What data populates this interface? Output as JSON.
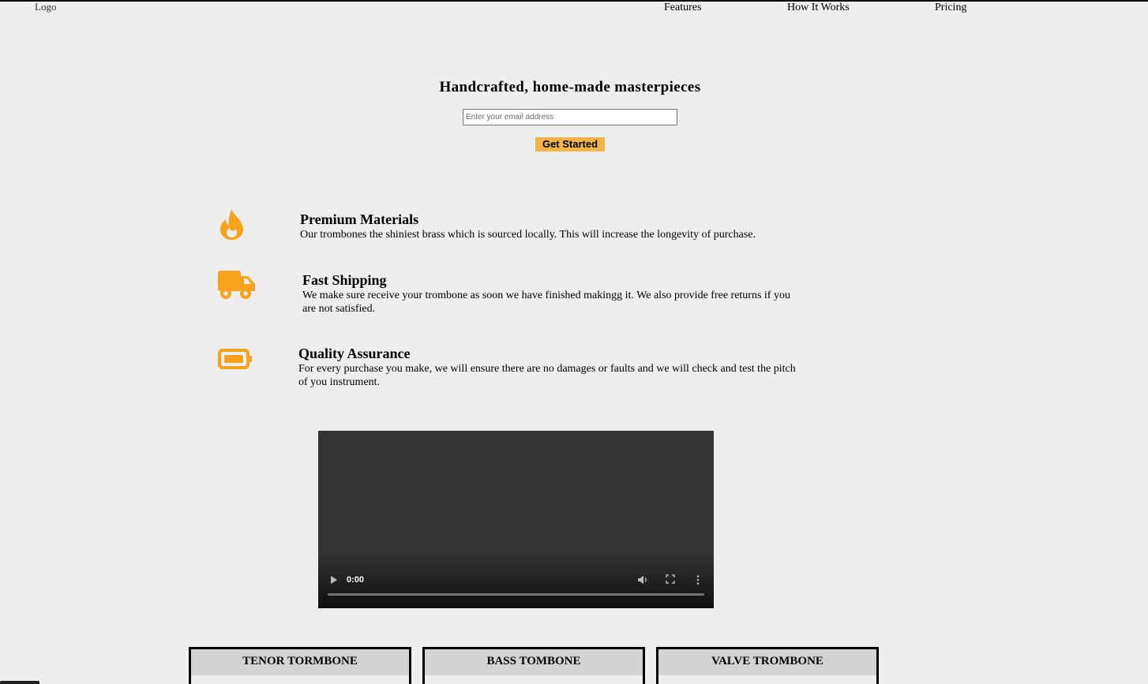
{
  "header": {
    "logo_alt": "Logo",
    "nav": [
      {
        "label": "Features"
      },
      {
        "label": "How It Works"
      },
      {
        "label": "Pricing"
      }
    ]
  },
  "hero": {
    "title": "Handcrafted, home-made masterpieces",
    "email_placeholder": "Enter your email address",
    "cta_label": "Get Started"
  },
  "features": [
    {
      "icon": "fire-icon",
      "title": "Premium Materials",
      "text": "Our trombones the shiniest brass which is sourced locally. This will increase the longevity of purchase."
    },
    {
      "icon": "truck-icon",
      "title": "Fast Shipping",
      "text": "We make sure receive your trombone as soon we have finished makingg it. We also provide free returns if you are not satisfied."
    },
    {
      "icon": "battery-icon",
      "title": "Quality Assurance",
      "text": "For every purchase you make, we will ensure there are no damages or faults and we will check and test the pitch of you instrument."
    }
  ],
  "video": {
    "time": "0:00"
  },
  "pricing": [
    {
      "title": "TENOR TORMBONE"
    },
    {
      "title": "BASS TOMBONE"
    },
    {
      "title": "VALVE TROMBONE"
    }
  ],
  "colors": {
    "accent": "#f0b449",
    "icon": "#f7a21b",
    "background": "#eeeeee",
    "video": "#333333"
  }
}
